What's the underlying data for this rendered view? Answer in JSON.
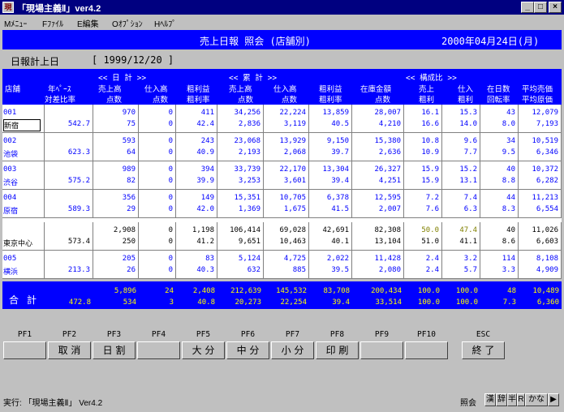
{
  "window": {
    "title": "「現場主義Ⅱ」ver4.2",
    "icon_glyph": "現",
    "min": "_",
    "max": "□",
    "close": "×"
  },
  "menu": [
    "Mﾒﾆｭｰ",
    "Fﾌｧｲﾙ",
    "E編集",
    "Oｵﾌﾟｼｮﾝ",
    "Hﾍﾙﾌﾟ"
  ],
  "report": {
    "title": "売上日報 照会 (店舗別)",
    "date": "2000年04月24日(月)"
  },
  "daily": {
    "label": "日報計上日",
    "value": "[ 1999/12/20 ]"
  },
  "columns": {
    "daily_group": "<<  日     計  >>",
    "cum_group": "<<  累     計  >>",
    "ratio_group": "<< 構成比 >>",
    "h1_store": "店舗",
    "h1_pace": "年ﾍﾟｰｽ",
    "h2_pace": "対差比率",
    "h1_sales": "売上高",
    "h2_sales": "点数",
    "h1_purch": "仕入高",
    "h2_purch": "点数",
    "h1_gp": "粗利益",
    "h2_gp": "粗利率",
    "h1_csales": "売上高",
    "h2_csales": "点数",
    "h1_cpurch": "仕入高",
    "h2_cpurch": "点数",
    "h1_cgp": "粗利益",
    "h2_cgp": "粗利率",
    "h1_inv": "在庫金額",
    "h2_inv": "点数",
    "h1_rsales": "売上",
    "h2_rsales": "粗利",
    "h1_rpurch": "仕入",
    "h2_rpurch": "粗利",
    "h1_days": "在日数",
    "h2_days": "回転率",
    "h1_avg": "平均売価",
    "h2_avg": "平均原価"
  },
  "rows": [
    {
      "code": "001",
      "name": "新宿",
      "pace": "542.7",
      "d_sales": "970",
      "d_qty": "75",
      "d_purch": "0",
      "d_pqty": "0",
      "d_gp": "411",
      "d_gpr": "42.4",
      "c_sales": "34,256",
      "c_qty": "2,836",
      "c_purch": "22,224",
      "c_pqty": "3,119",
      "c_gp": "13,859",
      "c_gpr": "40.5",
      "inv": "28,007",
      "inv_qty": "4,210",
      "r_sales": "16.1",
      "r_sales2": "16.6",
      "r_purch": "15.3",
      "r_purch2": "14.0",
      "days": "43",
      "turn": "8.0",
      "avg_price": "12,079",
      "avg_cost": "7,193"
    },
    {
      "code": "002",
      "name": "池袋",
      "pace": "623.3",
      "d_sales": "593",
      "d_qty": "64",
      "d_purch": "0",
      "d_pqty": "0",
      "d_gp": "243",
      "d_gpr": "40.9",
      "c_sales": "23,068",
      "c_qty": "2,193",
      "c_purch": "13,929",
      "c_pqty": "2,068",
      "c_gp": "9,150",
      "c_gpr": "39.7",
      "inv": "15,380",
      "inv_qty": "2,636",
      "r_sales": "10.8",
      "r_sales2": "10.9",
      "r_purch": "9.6",
      "r_purch2": "7.7",
      "days": "34",
      "turn": "9.5",
      "avg_price": "10,519",
      "avg_cost": "6,346"
    },
    {
      "code": "003",
      "name": "渋谷",
      "pace": "575.2",
      "d_sales": "989",
      "d_qty": "82",
      "d_purch": "0",
      "d_pqty": "0",
      "d_gp": "394",
      "d_gpr": "39.9",
      "c_sales": "33,739",
      "c_qty": "3,253",
      "c_purch": "22,170",
      "c_pqty": "3,601",
      "c_gp": "13,304",
      "c_gpr": "39.4",
      "inv": "26,327",
      "inv_qty": "4,251",
      "r_sales": "15.9",
      "r_sales2": "15.9",
      "r_purch": "15.2",
      "r_purch2": "13.1",
      "days": "40",
      "turn": "8.8",
      "avg_price": "10,372",
      "avg_cost": "6,282"
    },
    {
      "code": "004",
      "name": "原宿",
      "pace": "589.3",
      "d_sales": "356",
      "d_qty": "29",
      "d_purch": "0",
      "d_pqty": "0",
      "d_gp": "149",
      "d_gpr": "42.0",
      "c_sales": "15,351",
      "c_qty": "1,369",
      "c_purch": "10,705",
      "c_pqty": "1,675",
      "c_gp": "6,378",
      "c_gpr": "41.5",
      "inv": "12,595",
      "inv_qty": "2,007",
      "r_sales": "7.2",
      "r_sales2": "7.6",
      "r_purch": "7.4",
      "r_purch2": "6.3",
      "days": "44",
      "turn": "8.3",
      "avg_price": "11,213",
      "avg_cost": "6,554"
    },
    {
      "code": "",
      "name": "東京中心",
      "pace": "573.4",
      "d_sales": "2,908",
      "d_qty": "250",
      "d_purch": "0",
      "d_pqty": "0",
      "d_gp": "1,198",
      "d_gpr": "41.2",
      "c_sales": "106,414",
      "c_qty": "9,651",
      "c_purch": "69,028",
      "c_pqty": "10,463",
      "c_gp": "42,691",
      "c_gpr": "40.1",
      "inv": "82,308",
      "inv_qty": "13,104",
      "r_sales": "50.0",
      "r_sales2": "51.0",
      "r_purch": "47.4",
      "r_purch2": "41.1",
      "days": "40",
      "turn": "8.6",
      "avg_price": "11,026",
      "avg_cost": "6,603"
    },
    {
      "code": "005",
      "name": "横浜",
      "pace": "213.3",
      "d_sales": "205",
      "d_qty": "26",
      "d_purch": "0",
      "d_pqty": "0",
      "d_gp": "83",
      "d_gpr": "40.3",
      "c_sales": "5,124",
      "c_qty": "632",
      "c_purch": "4,725",
      "c_pqty": "885",
      "c_gp": "2,022",
      "c_gpr": "39.5",
      "inv": "11,428",
      "inv_qty": "2,080",
      "r_sales": "2.4",
      "r_sales2": "2.4",
      "r_purch": "3.2",
      "r_purch2": "5.7",
      "days": "114",
      "turn": "3.3",
      "avg_price": "8,108",
      "avg_cost": "4,909"
    }
  ],
  "total": {
    "label": "合計",
    "pace": "472.8",
    "d_sales": "5,896",
    "d_qty": "534",
    "d_purch": "24",
    "d_pqty": "3",
    "d_gp": "2,408",
    "d_gpr": "40.8",
    "c_sales": "212,639",
    "c_qty": "20,273",
    "c_purch": "145,532",
    "c_pqty": "22,254",
    "c_gp": "83,708",
    "c_gpr": "39.4",
    "inv": "200,434",
    "inv_qty": "33,514",
    "r_sales": "100.0",
    "r_sales2": "100.0",
    "r_purch": "100.0",
    "r_purch2": "100.0",
    "days": "48",
    "turn": "7.3",
    "avg_price": "10,489",
    "avg_cost": "6,360"
  },
  "fkeys": [
    {
      "key": "PF1",
      "label": ""
    },
    {
      "key": "PF2",
      "label": "取 消"
    },
    {
      "key": "PF3",
      "label": "日 割"
    },
    {
      "key": "PF4",
      "label": ""
    },
    {
      "key": "PF5",
      "label": "大 分"
    },
    {
      "key": "PF6",
      "label": "中 分"
    },
    {
      "key": "PF7",
      "label": "小 分"
    },
    {
      "key": "PF8",
      "label": "印 刷"
    },
    {
      "key": "PF9",
      "label": ""
    },
    {
      "key": "PF10",
      "label": ""
    },
    {
      "key": "ESC",
      "label": "終 了"
    }
  ],
  "status": {
    "text": "実行: 「現場主義Ⅱ」 Ver4.2",
    "mode": "照会",
    "ime": [
      "漢",
      "辞",
      "半",
      "R",
      "かな",
      "▶"
    ]
  }
}
